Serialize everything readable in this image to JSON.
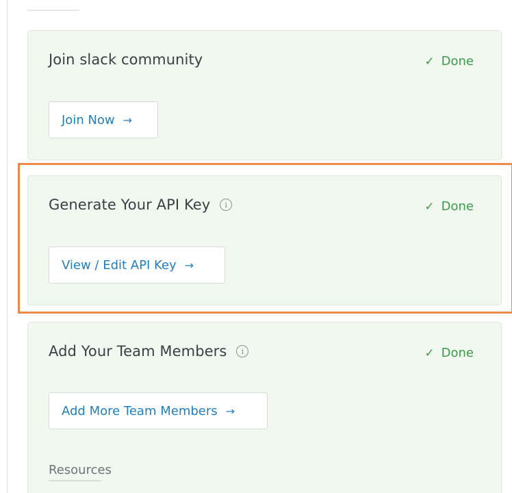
{
  "cards": [
    {
      "title": "Join slack community",
      "status": "Done",
      "button_label": "Join Now",
      "has_info": false
    },
    {
      "title": "Generate Your API Key",
      "status": "Done",
      "button_label": "View / Edit API Key",
      "has_info": true
    },
    {
      "title": "Add Your Team Members",
      "status": "Done",
      "button_label": "Add More Team Members",
      "has_info": true,
      "resources_label": "Resources"
    }
  ],
  "icons": {
    "check": "✓",
    "arrow": "→",
    "info": "i"
  },
  "colors": {
    "card_background": "#f0f8ef",
    "done_green": "#3c9a4a",
    "link_blue": "#1f7fc0",
    "highlight_orange": "#ee8948"
  }
}
